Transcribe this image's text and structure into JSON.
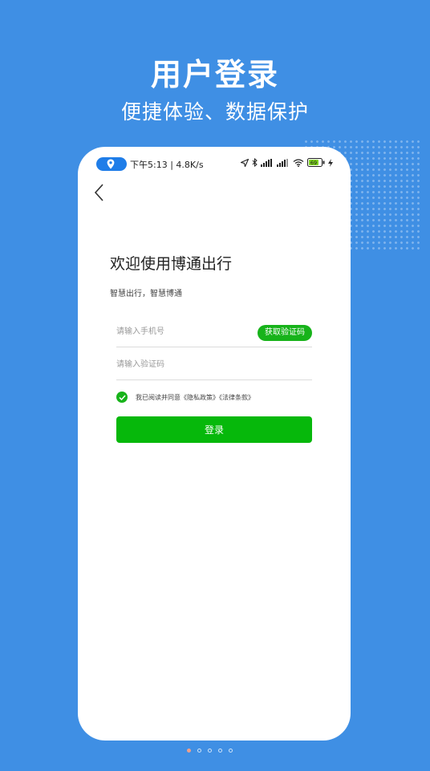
{
  "promo": {
    "title": "用户登录",
    "subtitle": "便捷体验、数据保护"
  },
  "status_bar": {
    "time_speed": "下午5:13 | 4.8K/s",
    "battery": "69"
  },
  "login": {
    "welcome_title": "欢迎使用博通出行",
    "welcome_subtitle": "智慧出行，智慧博通",
    "phone_placeholder": "请输入手机号",
    "phone_value": "",
    "get_code_label": "获取验证码",
    "code_placeholder": "请输入验证码",
    "code_value": "",
    "agreement_text": "我已阅读并同意《隐私政策》《法律条款》",
    "agreement_checked": true,
    "login_label": "登录"
  },
  "pager": {
    "count": 5,
    "active_index": 0
  },
  "colors": {
    "background": "#3f8fe4",
    "accent_green": "#17b31a",
    "location_pill": "#1f7de8"
  }
}
